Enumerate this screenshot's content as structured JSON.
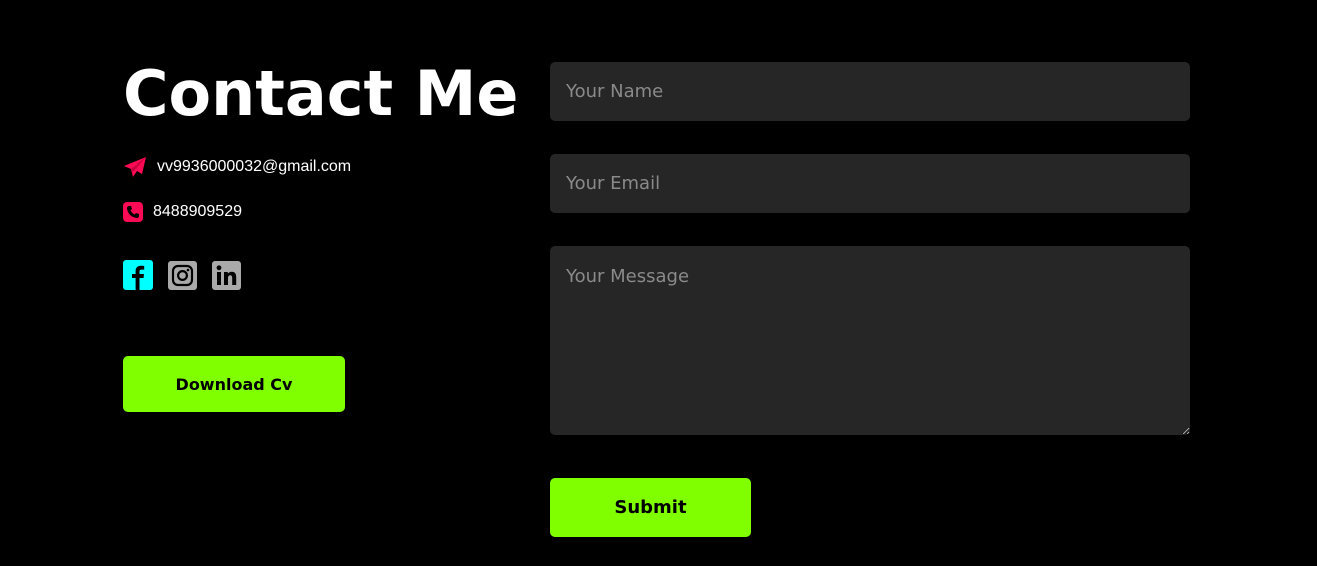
{
  "contact": {
    "title": "Contact Me",
    "email": "vv9936000032@gmail.com",
    "phone": "8488909529",
    "download_label": "Download Cv"
  },
  "social": {
    "icons": [
      "facebook-icon",
      "instagram-icon",
      "linkedin-icon"
    ]
  },
  "form": {
    "name_placeholder": "Your Name",
    "email_placeholder": "Your Email",
    "message_placeholder": "Your Message",
    "submit_label": "Submit"
  },
  "colors": {
    "background": "#000000",
    "accent_green": "#7fff00",
    "icon_pink": "#ff0a54",
    "facebook_cyan": "#00ffff",
    "social_gray": "#a9a9a9",
    "field_bg": "#262626"
  }
}
